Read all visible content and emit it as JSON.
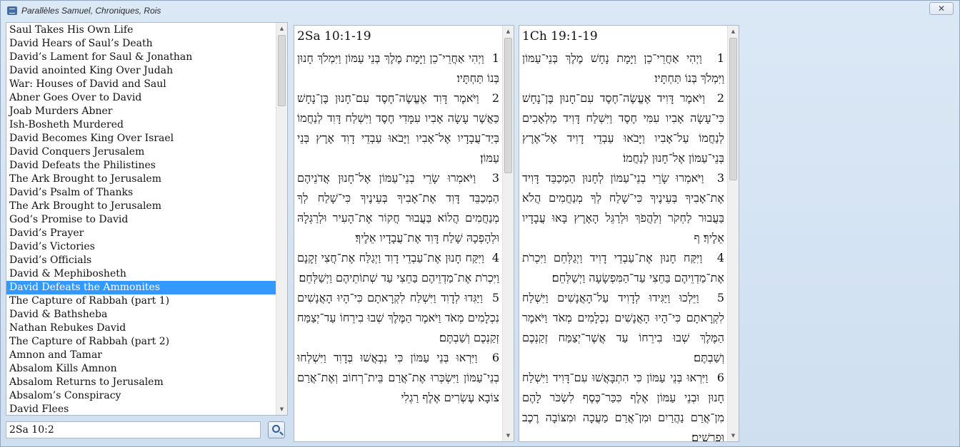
{
  "window": {
    "title": "Parallèles Samuel, Chroniques, Rois",
    "close_label": "✕"
  },
  "sections": [
    "Saul Takes His Own Life",
    "David Hears of Saul’s Death",
    "David’s Lament for Saul & Jonathan",
    "David anointed King Over Judah",
    "War: Houses of David and Saul",
    "Abner Goes Over to David",
    "Joab Murders Abner",
    "Ish-Bosheth Murdered",
    "David Becomes King Over Israel",
    "David Conquers Jerusalem",
    "David Defeats the Philistines",
    "The Ark Brought to Jerusalem",
    "David’s Psalm of Thanks",
    "The Ark Brought to Jerusalem",
    "God’s Promise to David",
    "David’s Prayer",
    "David’s Victories",
    "David’s Officials",
    "David & Mephibosheth",
    "David Defeats the Ammonites",
    "The Capture of Rabbah (part 1)",
    "David & Bathsheba",
    "Nathan Rebukes David",
    "The Capture of Rabbah (part 2)",
    "Amnon and Tamar",
    "Absalom Kills Amnon",
    "Absalom Returns to Jerusalem",
    "Absalom’s Conspiracy",
    "David Flees"
  ],
  "selected_section": "David Defeats the Ammonites",
  "reference_input": {
    "value": "2Sa 10:2"
  },
  "passages": [
    {
      "reference": "2Sa 10:1-19",
      "verses": [
        {
          "num": "1",
          "text": "וַיְהִי אַחֲרֵי־כֵן וַיָּמָת מֶלֶךְ בְּנֵי עַמּוֹן וַיִּמְלֹךְ חָנוּן בְּנוֹ תַּחְתָּיו׃"
        },
        {
          "num": "2",
          "text": "וַיֹּאמֶר דָּוִד אֶעֱשֶׂה־חֶסֶד עִם־חָנוּן בֶּן־נָחָשׁ כַּאֲשֶׁר עָשָׂה אָבִיו עִמָּדִי חֶסֶד וַיִּשְׁלַח דָּוִד לְנַחֲמוֹ בְּיַד־עֲבָדָיו אֶל־אָבִיו וַיָּבֹאוּ עַבְדֵי דָוִד אֶרֶץ בְּנֵי עַמּוֹן׃"
        },
        {
          "num": "3",
          "text": "וַיֹּאמְרוּ שָׂרֵי בְנֵי־עַמּוֹן אֶל־חָנוּן אֲדֹנֵיהֶם הַמְכַבֵּד דָּוִד אֶת־אָבִיךָ בְּעֵינֶיךָ כִּי־שָׁלַח לְךָ מְנַחֲמִים הֲלוֹא בַּעֲבוּר חֲקוֹר אֶת־הָעִיר וּלְרַגְּלָהּ וּלְהָפְכָהּ שָׁלַח דָּוִד אֶת־עֲבָדָיו אֵלֶיךָ׃"
        },
        {
          "num": "4",
          "text": "וַיִּקַּח חָנוּן אֶת־עַבְדֵי דָוִד וַיְגַלַּח אֶת־חֲצִי זְקָנָם וַיִּכְרֹת אֶת־מַדְוֵיהֶם בַּחֵצִי עַד שְׁתוֹתֵיהֶם וַיְשַׁלְּחֵם׃"
        },
        {
          "num": "5",
          "text": "וַיַּגִּדוּ לְדָוִד וַיִּשְׁלַח לִקְרָאתָם כִּי־הָיוּ הָאֲנָשִׁים נִכְלָמִים מְאֹד וַיֹּאמֶר הַמֶּלֶךְ שְׁבוּ בִירֵחוֹ עַד־יְצַמַּח זְקַנְכֶם וְשַׁבְתֶּם׃"
        },
        {
          "num": "6",
          "text": "וַיִּרְאוּ בְּנֵי עַמּוֹן כִּי נִבְאֲשׁוּ בְּדָוִד וַיִּשְׁלְחוּ בְנֵי־עַמּוֹן וַיִּשְׂכְּרוּ אֶת־אֲרַם בֵּית־רְחוֹב וְאֶת־אֲרַם צוֹבָא עֶשְׂרִים אֶלֶף רַגְלִי"
        }
      ]
    },
    {
      "reference": "1Ch 19:1-19",
      "verses": [
        {
          "num": "1",
          "text": "וַיְהִי אַחֲרֵי־כֵן וַיָּמָת נָחָשׁ מֶלֶךְ בְּנֵי־עַמּוֹן וַיִּמְלֹךְ בְּנוֹ תַּחְתָּיו׃"
        },
        {
          "num": "2",
          "text": "וַיֹּאמֶר דָּוִיד אֶעֱשֶׂה־חֶסֶד עִם־חָנוּן בֶּן־נָחָשׁ כִּי־עָשָׂה אָבִיו עִמִּי חֶסֶד וַיִּשְׁלַח דָּוִיד מַלְאָכִים לְנַחֲמוֹ עַל־אָבִיו וַיָּבֹאוּ עַבְדֵי דָוִיד אֶל־אֶרֶץ בְּנֵי־עַמּוֹן אֶל־חָנוּן לְנַחֲמוֹ׃"
        },
        {
          "num": "3",
          "text": "וַיֹּאמְרוּ שָׂרֵי בְנֵי־עַמּוֹן לְחָנוּן הַמְכַבֵּד דָּוִיד אֶת־אָבִיךָ בְּעֵינֶיךָ כִּי־שָׁלַח לְךָ מְנַחֲמִים הֲלֹא בַּעֲבוּר לַחְקֹר וְלַהֲפֹךְ וּלְרַגֵּל הָאָרֶץ בָּאוּ עֲבָדָיו אֵלֶיךָ׃ ף"
        },
        {
          "num": "4",
          "text": "וַיִּקַּח חָנוּן אֶת־עַבְדֵי דָוִיד וַיְגַלְּחֵם וַיִּכְרֹת אֶת־מַדְוֵיהֶם בַּחֵצִי עַד־הַמִּפְשָׂעָה וַיְשַׁלְּחֵם׃"
        },
        {
          "num": "5",
          "text": "וַיֵּלְכוּ וַיַּגִּידוּ לְדָוִיד עַל־הָאֲנָשִׁים וַיִּשְׁלַח לִקְרָאתָם כִּי־הָיוּ הָאֲנָשִׁים נִכְלָמִים מְאֹד וַיֹּאמֶר הַמֶּלֶךְ שְׁבוּ בִירֵחוֹ עַד אֲשֶׁר־יְצַמַּח זְקַנְכֶם וְשַׁבְתֶּם׃"
        },
        {
          "num": "6",
          "text": "וַיִּרְאוּ בְּנֵי עַמּוֹן כִּי הִתְבָּאֲשׁוּ עִם־דָּוִיד וַיִּשְׁלַח חָנוּן וּבְנֵי עַמּוֹן אֶלֶף כִּכַּר־כֶּסֶף לִשְׂכֹּר לָהֶם מִן־אֲרַם נַהֲרַיִם וּמִן־אֲרַם מַעֲכָה וּמִצּוֹבָה רֶכֶב וּפָרָשִׁים׃"
        }
      ]
    }
  ]
}
